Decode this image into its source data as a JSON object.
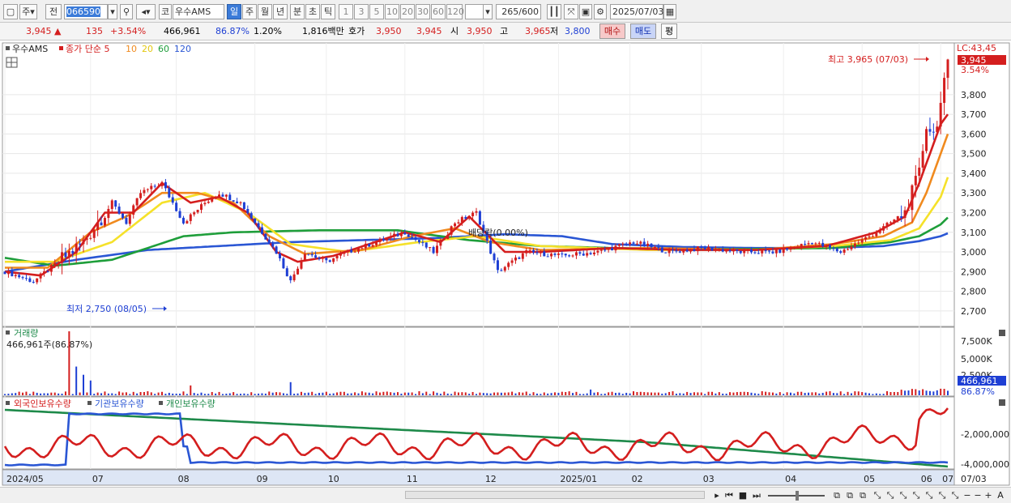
{
  "toolbar": {
    "market_label": "주",
    "prev_label": "전",
    "code": "066590",
    "market_prefix": "코",
    "stock_name": "우수AMS",
    "periods": [
      "일",
      "주",
      "월",
      "년",
      "분",
      "초",
      "틱"
    ],
    "intervals": [
      "1",
      "3",
      "5",
      "10",
      "20",
      "30",
      "60",
      "120"
    ],
    "count": "265",
    "count_max": "/600",
    "date": "2025/07/03",
    "colors": {
      "selected": "#3b7bd9"
    }
  },
  "quote": {
    "price": "3,945",
    "change": "135",
    "change_pct": "+3.54%",
    "volume": "466,961",
    "vol_ratio": "86.87%",
    "turnover": "1.20%",
    "amount": "1,816백만",
    "ask_label": "호가",
    "ask1": "3,950",
    "ask2": "3,945",
    "open_label": "시",
    "open": "3,950",
    "high_label": "고",
    "high": "3,965",
    "low_label": "저",
    "low": "3,800",
    "buy_label": "매수",
    "sell_label": "매도",
    "avg_label": "평"
  },
  "main_panel": {
    "stock_label": "우수AMS",
    "ma_label": "종가 단순 5",
    "ma_periods": [
      "10",
      "20",
      "60",
      "120"
    ],
    "lc_label": "LC:43,45",
    "price_tag": "3,945",
    "pct_tag": "3.54%",
    "high_note": "최고 3,965 (07/03)",
    "low_note": "최저 2,750 (08/05)",
    "dividend_note": "배당락(0.00%)",
    "colors": {
      "ma5": "#d41e1e",
      "ma10": "#f08a1e",
      "ma20": "#f5e12a",
      "ma60": "#1e9e3a",
      "ma120": "#2a56d4"
    }
  },
  "volume_panel": {
    "title": "거래량",
    "value_label": "466,961주(86.87%)",
    "axis_labels": [
      "7,500K",
      "5,000K",
      "2,500K"
    ],
    "current_tag": "466,961",
    "pct_tag": "86.87%"
  },
  "holdings_panel": {
    "legend": [
      "외국인보유수량",
      "기관보유수량",
      "개인보유수량"
    ],
    "axis_labels": [
      "-2,000,000",
      "-4,000,000"
    ],
    "colors": {
      "foreign": "#d41e1e",
      "institution": "#2a56d4",
      "individual": "#1e8a4a"
    }
  },
  "x_axis": {
    "labels": [
      "2024/05",
      "07",
      "08",
      "09",
      "10",
      "11",
      "12",
      "2025/01",
      "02",
      "03",
      "04",
      "05",
      "06",
      "07",
      "07/03"
    ]
  },
  "chart_data": {
    "type": "candlestick",
    "y_axis_ticks": [
      2700,
      2800,
      2900,
      3000,
      3100,
      3200,
      3300,
      3400,
      3500,
      3600,
      3700,
      3800
    ],
    "ylim": [
      2650,
      4030
    ],
    "high": {
      "value": 3965,
      "date": "07/03"
    },
    "low": {
      "value": 2750,
      "date": "08/05"
    },
    "last_close": 3945,
    "price_path": [
      [
        0,
        2900
      ],
      [
        8,
        2850
      ],
      [
        15,
        2950
      ],
      [
        22,
        3050
      ],
      [
        26,
        3150
      ],
      [
        30,
        3250
      ],
      [
        34,
        3150
      ],
      [
        38,
        3300
      ],
      [
        44,
        3350
      ],
      [
        50,
        3150
      ],
      [
        56,
        3250
      ],
      [
        60,
        3300
      ],
      [
        66,
        3250
      ],
      [
        70,
        3150
      ],
      [
        76,
        3000
      ],
      [
        80,
        2850
      ],
      [
        84,
        3000
      ],
      [
        90,
        2950
      ],
      [
        96,
        3000
      ],
      [
        104,
        3050
      ],
      [
        112,
        3100
      ],
      [
        120,
        3000
      ],
      [
        126,
        3150
      ],
      [
        132,
        3200
      ],
      [
        138,
        2900
      ],
      [
        146,
        3000
      ],
      [
        156,
        2980
      ],
      [
        166,
        3000
      ],
      [
        176,
        3050
      ],
      [
        186,
        3000
      ],
      [
        196,
        3020
      ],
      [
        206,
        3000
      ],
      [
        216,
        3000
      ],
      [
        226,
        3050
      ],
      [
        234,
        3000
      ],
      [
        244,
        3100
      ],
      [
        252,
        3200
      ],
      [
        256,
        3400
      ],
      [
        258,
        3650
      ],
      [
        260,
        3600
      ],
      [
        262,
        3750
      ],
      [
        264,
        3945
      ]
    ],
    "ma5_path": [
      [
        0,
        2900
      ],
      [
        10,
        2880
      ],
      [
        20,
        3000
      ],
      [
        28,
        3200
      ],
      [
        36,
        3200
      ],
      [
        44,
        3350
      ],
      [
        52,
        3250
      ],
      [
        60,
        3280
      ],
      [
        68,
        3200
      ],
      [
        76,
        3000
      ],
      [
        82,
        2950
      ],
      [
        92,
        2980
      ],
      [
        102,
        3040
      ],
      [
        112,
        3100
      ],
      [
        122,
        3050
      ],
      [
        130,
        3180
      ],
      [
        140,
        3000
      ],
      [
        150,
        3000
      ],
      [
        170,
        3020
      ],
      [
        190,
        3010
      ],
      [
        210,
        3010
      ],
      [
        230,
        3030
      ],
      [
        244,
        3100
      ],
      [
        252,
        3180
      ],
      [
        256,
        3350
      ],
      [
        260,
        3550
      ],
      [
        262,
        3650
      ],
      [
        264,
        3700
      ]
    ],
    "ma10_path": [
      [
        0,
        2920
      ],
      [
        12,
        2920
      ],
      [
        24,
        3100
      ],
      [
        34,
        3180
      ],
      [
        44,
        3300
      ],
      [
        54,
        3300
      ],
      [
        64,
        3250
      ],
      [
        74,
        3080
      ],
      [
        84,
        2990
      ],
      [
        100,
        3010
      ],
      [
        114,
        3080
      ],
      [
        126,
        3120
      ],
      [
        136,
        3050
      ],
      [
        150,
        3010
      ],
      [
        180,
        3020
      ],
      [
        210,
        3010
      ],
      [
        232,
        3040
      ],
      [
        246,
        3080
      ],
      [
        254,
        3150
      ],
      [
        258,
        3300
      ],
      [
        262,
        3500
      ],
      [
        264,
        3600
      ]
    ],
    "ma20_path": [
      [
        0,
        2950
      ],
      [
        14,
        2950
      ],
      [
        30,
        3050
      ],
      [
        44,
        3250
      ],
      [
        56,
        3300
      ],
      [
        68,
        3200
      ],
      [
        80,
        3040
      ],
      [
        96,
        3000
      ],
      [
        116,
        3050
      ],
      [
        132,
        3080
      ],
      [
        150,
        3030
      ],
      [
        180,
        3010
      ],
      [
        210,
        3010
      ],
      [
        232,
        3030
      ],
      [
        248,
        3060
      ],
      [
        256,
        3120
      ],
      [
        262,
        3280
      ],
      [
        264,
        3380
      ]
    ],
    "ma60_path": [
      [
        0,
        2970
      ],
      [
        14,
        2930
      ],
      [
        30,
        2960
      ],
      [
        50,
        3080
      ],
      [
        64,
        3100
      ],
      [
        88,
        3110
      ],
      [
        110,
        3110
      ],
      [
        130,
        3060
      ],
      [
        150,
        3030
      ],
      [
        170,
        3020
      ],
      [
        190,
        3015
      ],
      [
        210,
        3015
      ],
      [
        232,
        3020
      ],
      [
        248,
        3050
      ],
      [
        256,
        3080
      ],
      [
        262,
        3140
      ],
      [
        264,
        3175
      ]
    ],
    "ma120_path": [
      [
        0,
        2900
      ],
      [
        20,
        2960
      ],
      [
        40,
        3010
      ],
      [
        60,
        3030
      ],
      [
        80,
        3050
      ],
      [
        100,
        3060
      ],
      [
        120,
        3070
      ],
      [
        140,
        3090
      ],
      [
        156,
        3080
      ],
      [
        170,
        3040
      ],
      [
        190,
        3025
      ],
      [
        210,
        3020
      ],
      [
        230,
        3020
      ],
      [
        246,
        3030
      ],
      [
        256,
        3055
      ],
      [
        262,
        3080
      ],
      [
        264,
        3095
      ]
    ],
    "volume_spikes": [
      [
        18,
        7800
      ],
      [
        20,
        3500
      ],
      [
        22,
        2500
      ],
      [
        24,
        1800
      ],
      [
        52,
        1200
      ],
      [
        80,
        1600
      ],
      [
        164,
        700
      ]
    ]
  }
}
